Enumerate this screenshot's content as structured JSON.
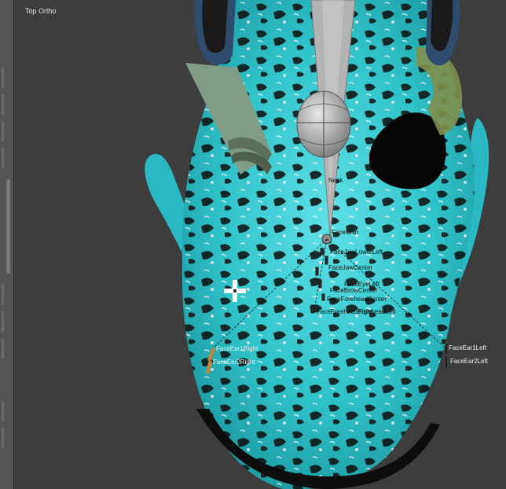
{
  "viewport": {
    "view_label": "Top Ortho"
  },
  "bones": {
    "neck": "Neck",
    "face_chin": "FaceChin",
    "jaw_lower_left": "FaceJawLowerLeft",
    "jaw_center": "FaceJawCenter",
    "eye_left": "FaceEyeLeft",
    "brow_center": "FaceBrowCenter",
    "forehead_center": "FaceForeheadCenter",
    "forehead_left": "ForeheadLeft",
    "forehead_right": "FaceForeheadRight",
    "ear1_right": "FaceEar1Right",
    "ear2_right": "FaceEar2Right",
    "ear1_left": "FaceEar1Left",
    "ear2_left": "FaceEar2Left"
  },
  "colors": {
    "background": "#3d3d3d",
    "skin_cyan": "#2fc4c9",
    "skin_dark": "#101010",
    "bone_gray": "#9a9a9a",
    "ear_bone": "#c8843a"
  },
  "icons": {
    "cursor": "crosshair-cursor-icon"
  }
}
